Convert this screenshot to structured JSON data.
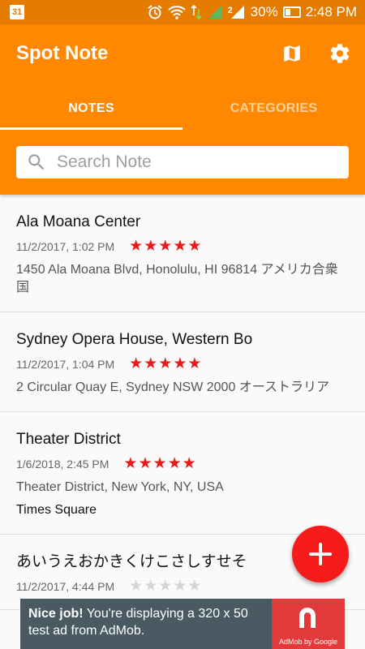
{
  "status_bar": {
    "calendar_day": "31",
    "network_badge": "2",
    "battery": "30%",
    "time": "2:48 PM"
  },
  "app": {
    "title": "Spot Note",
    "accent": "#ff8800",
    "icons": [
      "map-icon",
      "settings-icon"
    ]
  },
  "tabs": [
    {
      "label": "NOTES",
      "active": true
    },
    {
      "label": "CATEGORIES",
      "active": false
    }
  ],
  "search": {
    "placeholder": "Search Note",
    "value": ""
  },
  "notes": [
    {
      "title": "Ala Moana Center",
      "date": "11/2/2017, 1:02 PM",
      "rating": 5,
      "address": "1450 Ala Moana Blvd, Honolulu, HI 96814 アメリカ合衆国",
      "extra": ""
    },
    {
      "title": "Sydney Opera House, Western Bo",
      "date": "11/2/2017, 1:04 PM",
      "rating": 5,
      "address": "2 Circular Quay E, Sydney NSW 2000 オーストラリア",
      "extra": ""
    },
    {
      "title": "Theater District",
      "date": "1/6/2018, 2:45 PM",
      "rating": 5,
      "address": "Theater District, New York, NY, USA",
      "extra": "Times Square"
    },
    {
      "title": "あいうえおかきくけこさしすせそ",
      "date": "11/2/2017, 4:44 PM",
      "rating": 0,
      "address": "",
      "extra": ""
    }
  ],
  "fab": {
    "icon": "plus-icon",
    "color": "#f51b1b"
  },
  "ad": {
    "bold": "Nice job!",
    "text": " You're displaying a 320 x 50 test ad from AdMob.",
    "logo_text": "AdMob by Google"
  }
}
